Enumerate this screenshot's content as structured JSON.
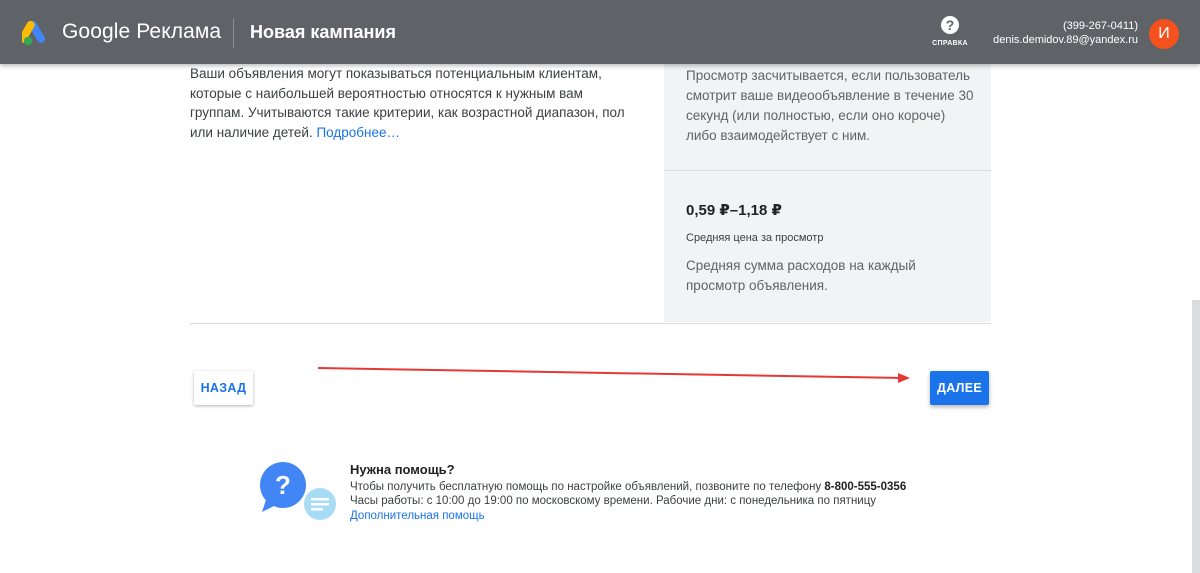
{
  "header": {
    "brand": "Google Реклама",
    "page_title": "Новая кампания",
    "help_label": "СПРАВКА",
    "account_id": "(399-267-0411)",
    "account_email": "denis.demidov.89@yandex.ru",
    "avatar_letter": "И"
  },
  "main": {
    "description": "Ваши объявления могут показываться потенциальным клиентам, которые с наибольшей вероятностью относятся к нужным вам группам. Учитываются такие критерии, как возрастной диапазон, пол или наличие детей. ",
    "learn_more": "Подробнее…"
  },
  "panel": {
    "view_text": "Просмотр засчитывается, если пользователь смотрит ваше видеообъявление в течение 30 секунд (или полностью, если оно короче) либо взаимодействует с ним.",
    "price": "0,59 ₽–1,18 ₽",
    "price_label": "Средняя цена за просмотр",
    "price_desc": "Средняя сумма расходов на каждый просмотр объявления."
  },
  "nav": {
    "back_label": "НАЗАД",
    "next_label": "ДАЛЕЕ"
  },
  "help": {
    "title": "Нужна помощь?",
    "line1": "Чтобы получить бесплатную помощь по настройке объявлений, позвоните по телефону ",
    "phone": "8-800-555-0356",
    "line2": "Часы работы: с 10:00 до 19:00 по московскому времени. Рабочие дни: с понедельника по пятницу",
    "more_link": "Дополнительная помощь"
  },
  "colors": {
    "topbar": "#5f6368",
    "accent": "#1a73e8",
    "avatar": "#f4511e",
    "annotation_arrow": "#e53935"
  },
  "icons": [
    "google-ads-logo-icon",
    "help-icon",
    "help-illustration-icon"
  ]
}
